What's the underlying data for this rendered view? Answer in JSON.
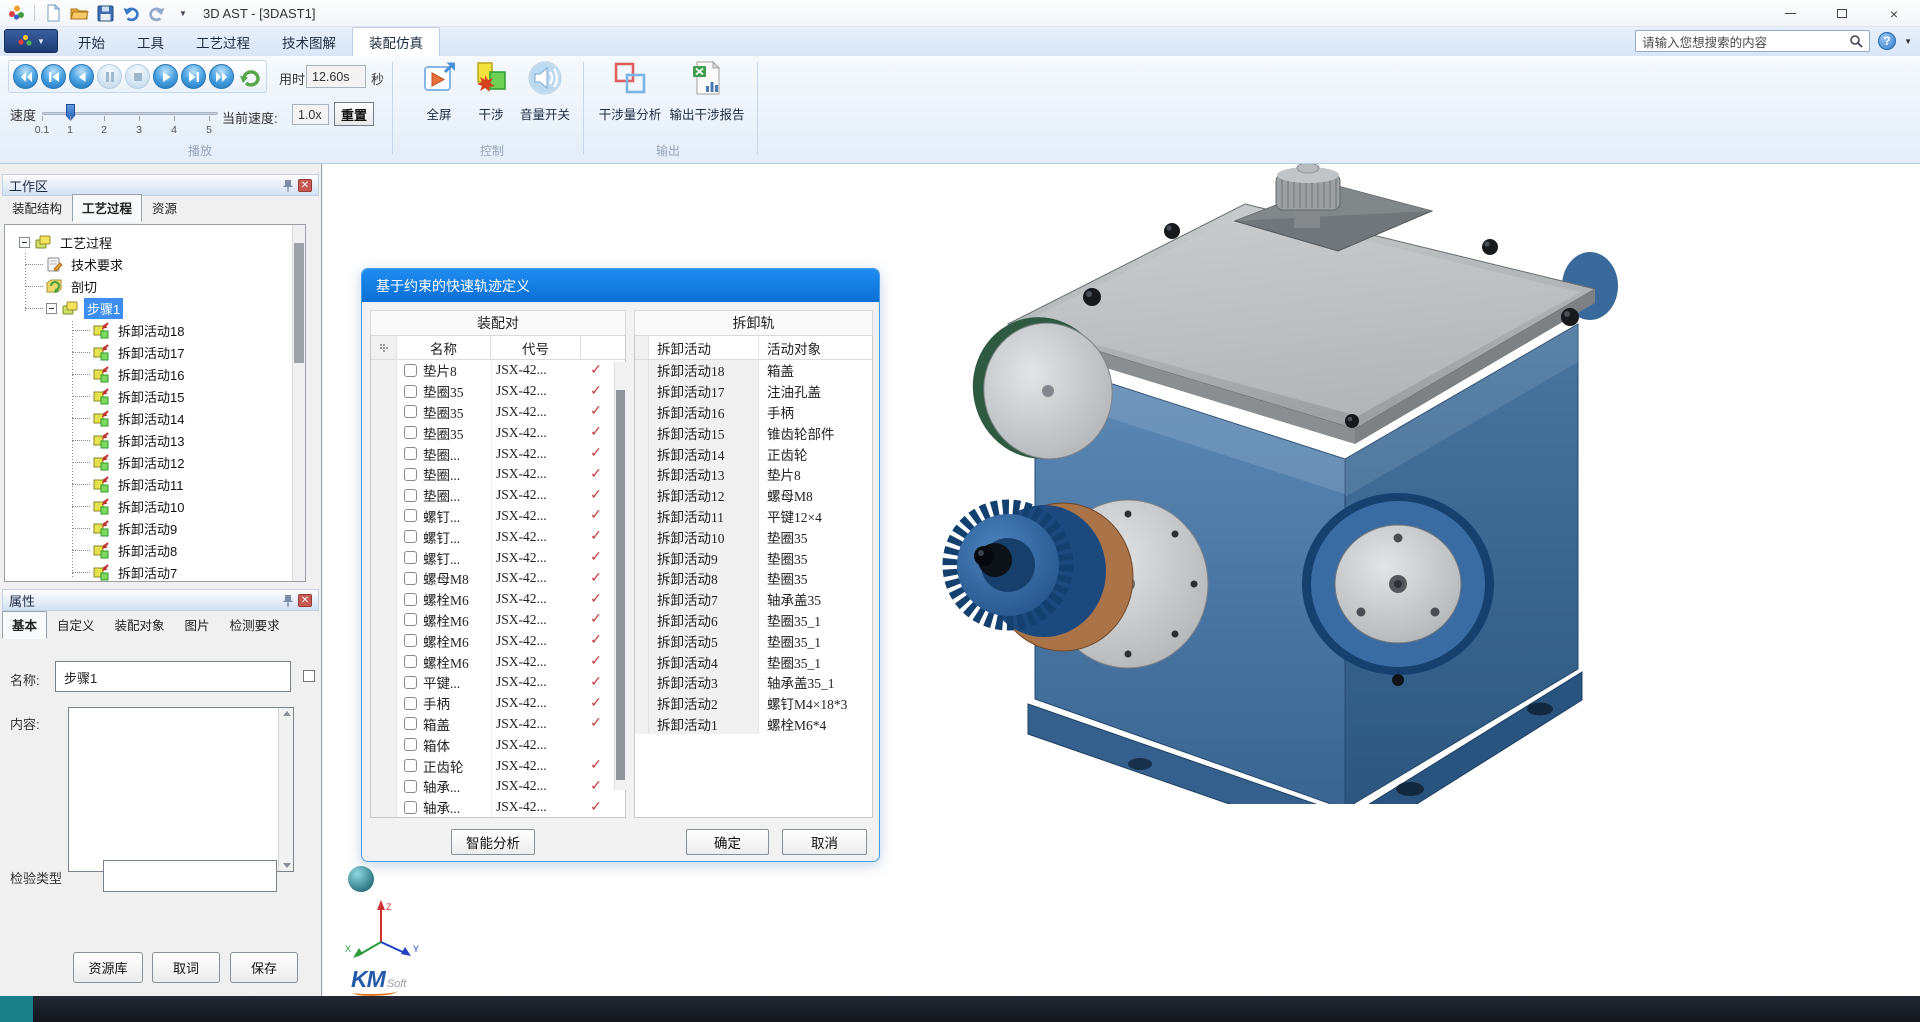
{
  "window": {
    "title": "3D AST - [3DAST1]"
  },
  "search": {
    "placeholder": "请输入您想搜索的内容"
  },
  "help": {
    "label": "?"
  },
  "ribbon_tabs": {
    "items": [
      "开始",
      "工具",
      "工艺过程",
      "技术图解",
      "装配仿真"
    ],
    "active": "装配仿真"
  },
  "ribbon": {
    "playback_icons": [
      "rewind",
      "previous",
      "step-back",
      "pause",
      "stop",
      "play",
      "next",
      "fast-forward",
      "replay"
    ],
    "elapsed": {
      "label": "用时",
      "value": "12.60s",
      "unit": "秒"
    },
    "speed": {
      "label": "速度",
      "ticks": [
        "0.1",
        "1",
        "2",
        "3",
        "4",
        "5"
      ],
      "value": "1"
    },
    "current_speed": {
      "label": "当前速度:",
      "value": "1.0x"
    },
    "reset_label": "重置",
    "groups": [
      {
        "label": "播放"
      },
      {
        "label": "控制"
      },
      {
        "label": "输出"
      }
    ],
    "control_buttons": [
      {
        "label": "全屏",
        "icon": "fullscreen"
      },
      {
        "label": "干涉",
        "icon": "interference"
      },
      {
        "label": "音量开关",
        "icon": "volume"
      }
    ],
    "output_buttons": [
      {
        "label": "干涉量分析",
        "icon": "interference-analysis"
      },
      {
        "label": "输出干涉报告",
        "icon": "interference-report"
      }
    ]
  },
  "workspace": {
    "title": "工作区",
    "tabs": [
      "装配结构",
      "工艺过程",
      "资源"
    ],
    "active_tab": "工艺过程",
    "tree": [
      {
        "label": "工艺过程",
        "depth": 0,
        "icon": "process",
        "expander": true
      },
      {
        "label": "技术要求",
        "depth": 1,
        "icon": "tech"
      },
      {
        "label": "剖切",
        "depth": 1,
        "icon": "section"
      },
      {
        "label": "步骤1",
        "depth": 1,
        "icon": "step",
        "expander": true,
        "selected": true
      },
      {
        "label": "拆卸活动18",
        "depth": 2,
        "icon": "activity"
      },
      {
        "label": "拆卸活动17",
        "depth": 2,
        "icon": "activity"
      },
      {
        "label": "拆卸活动16",
        "depth": 2,
        "icon": "activity"
      },
      {
        "label": "拆卸活动15",
        "depth": 2,
        "icon": "activity"
      },
      {
        "label": "拆卸活动14",
        "depth": 2,
        "icon": "activity"
      },
      {
        "label": "拆卸活动13",
        "depth": 2,
        "icon": "activity"
      },
      {
        "label": "拆卸活动12",
        "depth": 2,
        "icon": "activity"
      },
      {
        "label": "拆卸活动11",
        "depth": 2,
        "icon": "activity"
      },
      {
        "label": "拆卸活动10",
        "depth": 2,
        "icon": "activity"
      },
      {
        "label": "拆卸活动9",
        "depth": 2,
        "icon": "activity"
      },
      {
        "label": "拆卸活动8",
        "depth": 2,
        "icon": "activity"
      },
      {
        "label": "拆卸活动7",
        "depth": 2,
        "icon": "activity"
      }
    ]
  },
  "properties": {
    "title": "属性",
    "tabs": [
      "基本",
      "自定义",
      "装配对象",
      "图片",
      "检测要求"
    ],
    "active_tab": "基本",
    "name_label": "名称:",
    "name_value": "步骤1",
    "content_label": "内容:",
    "content_value": "",
    "check_type_label": "检验类型",
    "check_type_value": "",
    "buttons": [
      "资源库",
      "取词",
      "保存"
    ]
  },
  "dialog": {
    "title": "基于约束的快速轨迹定义",
    "assembly_pane": {
      "header": "装配对",
      "columns": [
        "名称",
        "代号"
      ],
      "rows": [
        {
          "name": "垫片8",
          "code": "JSX-42...",
          "checked": true
        },
        {
          "name": "垫圈35",
          "code": "JSX-42...",
          "checked": true
        },
        {
          "name": "垫圈35",
          "code": "JSX-42...",
          "checked": true
        },
        {
          "name": "垫圈35",
          "code": "JSX-42...",
          "checked": true
        },
        {
          "name": "垫圈...",
          "code": "JSX-42...",
          "checked": true
        },
        {
          "name": "垫圈...",
          "code": "JSX-42...",
          "checked": true
        },
        {
          "name": "垫圈...",
          "code": "JSX-42...",
          "checked": true
        },
        {
          "name": "螺钉...",
          "code": "JSX-42...",
          "checked": true
        },
        {
          "name": "螺钉...",
          "code": "JSX-42...",
          "checked": true
        },
        {
          "name": "螺钉...",
          "code": "JSX-42...",
          "checked": true
        },
        {
          "name": "螺母M8",
          "code": "JSX-42...",
          "checked": true
        },
        {
          "name": "螺栓M6",
          "code": "JSX-42...",
          "checked": true
        },
        {
          "name": "螺栓M6",
          "code": "JSX-42...",
          "checked": true
        },
        {
          "name": "螺栓M6",
          "code": "JSX-42...",
          "checked": true
        },
        {
          "name": "螺栓M6",
          "code": "JSX-42...",
          "checked": true
        },
        {
          "name": "平键...",
          "code": "JSX-42...",
          "checked": true
        },
        {
          "name": "手柄",
          "code": "JSX-42...",
          "checked": true
        },
        {
          "name": "箱盖",
          "code": "JSX-42...",
          "checked": true
        },
        {
          "name": "箱体",
          "code": "JSX-42...",
          "checked": false
        },
        {
          "name": "正齿轮",
          "code": "JSX-42...",
          "checked": true
        },
        {
          "name": "轴承...",
          "code": "JSX-42...",
          "checked": true
        },
        {
          "name": "轴承...",
          "code": "JSX-42...",
          "checked": true
        }
      ],
      "analyze_button": "智能分析"
    },
    "track_pane": {
      "header": "拆卸轨",
      "columns": [
        "拆卸活动",
        "活动对象"
      ],
      "rows": [
        [
          "拆卸活动18",
          "箱盖"
        ],
        [
          "拆卸活动17",
          "注油孔盖"
        ],
        [
          "拆卸活动16",
          "手柄"
        ],
        [
          "拆卸活动15",
          "锥齿轮部件"
        ],
        [
          "拆卸活动14",
          "正齿轮"
        ],
        [
          "拆卸活动13",
          "垫片8"
        ],
        [
          "拆卸活动12",
          "螺母M8"
        ],
        [
          "拆卸活动11",
          "平键12×4"
        ],
        [
          "拆卸活动10",
          "垫圈35"
        ],
        [
          "拆卸活动9",
          "垫圈35"
        ],
        [
          "拆卸活动8",
          "垫圈35"
        ],
        [
          "拆卸活动7",
          "轴承盖35"
        ],
        [
          "拆卸活动6",
          "垫圈35_1"
        ],
        [
          "拆卸活动5",
          "垫圈35_1"
        ],
        [
          "拆卸活动4",
          "垫圈35_1"
        ],
        [
          "拆卸活动3",
          "轴承盖35_1"
        ],
        [
          "拆卸活动2",
          "螺钉M4×18*3"
        ],
        [
          "拆卸活动1",
          "螺栓M6*4"
        ]
      ],
      "ok_button": "确定",
      "cancel_button": "取消"
    }
  },
  "viewport": {
    "brand": {
      "km": "KM",
      "soft": "Soft"
    },
    "gizmo_axes": [
      "X",
      "Y",
      "Z"
    ]
  },
  "colors": {
    "accent_blue": "#0f7ae5",
    "check_red": "#c23b3b",
    "selection_blue": "#3d8ef0",
    "status_teal": "#1b7f8a"
  }
}
